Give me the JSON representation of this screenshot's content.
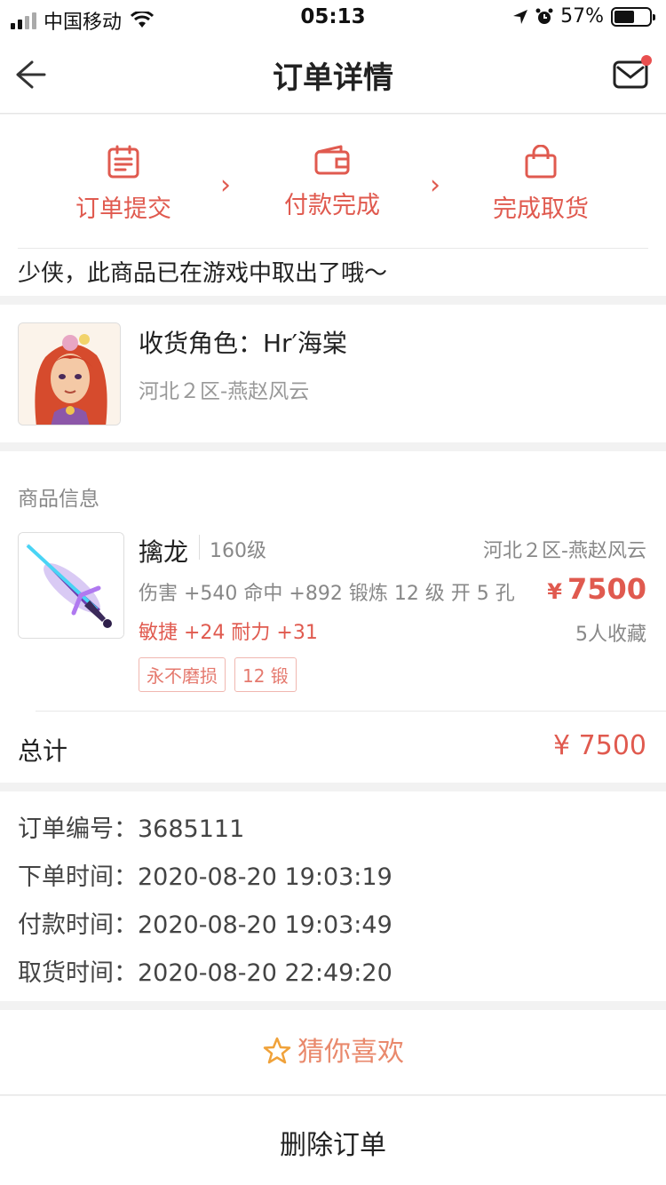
{
  "status_bar": {
    "carrier": "中国移动",
    "time": "05:13",
    "battery": "57%"
  },
  "nav": {
    "title": "订单详情"
  },
  "progress": {
    "steps": [
      "订单提交",
      "付款完成",
      "完成取货"
    ],
    "message": "少侠，此商品已在游戏中取出了哦～"
  },
  "role": {
    "name": "收货角色：Hr′海棠",
    "server": "河北２区-燕赵风云"
  },
  "goods": {
    "section_label": "商品信息",
    "item": {
      "name": "擒龙",
      "level": "160级",
      "server": "河北２区-燕赵风云",
      "attrs": "伤害 +540 命中 +892 锻炼 12 级 开 5 孔",
      "currency": "¥",
      "price": "7500",
      "bonus": "敏捷 +24 耐力 +31",
      "favorites": "5人收藏",
      "tags": [
        "永不磨损",
        "12 锻"
      ]
    },
    "total_label": "总计",
    "total_value": "¥ 7500"
  },
  "order_info": {
    "rows": [
      {
        "label": "订单编号：",
        "value": "3685111"
      },
      {
        "label": "下单时间：",
        "value": "2020-08-20 19:03:19"
      },
      {
        "label": "付款时间：",
        "value": "2020-08-20 19:03:49"
      },
      {
        "label": "取货时间：",
        "value": "2020-08-20 22:49:20"
      }
    ]
  },
  "guess": {
    "label": "猜你喜欢"
  },
  "delete": {
    "label": "删除订单"
  },
  "colors": {
    "accent": "#e05a4f",
    "guess": "#e9896c"
  }
}
